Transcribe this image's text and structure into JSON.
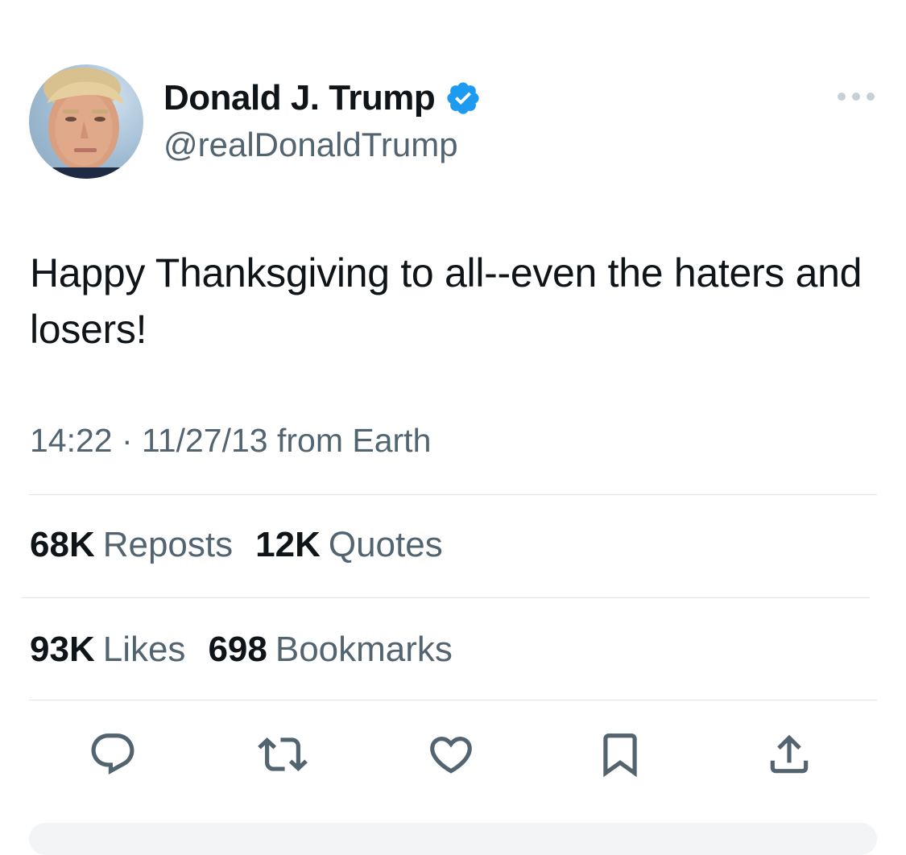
{
  "author": {
    "display_name": "Donald J. Trump",
    "handle": "@realDonaldTrump",
    "verified_icon": "verified-badge-icon",
    "avatar": "profile-photo"
  },
  "tweet": {
    "text": "Happy Thanksgiving to all--even the haters and losers!",
    "meta": "14:22 · 11/27/13 from Earth"
  },
  "stats": {
    "reposts_count": "68K",
    "reposts_label": "Reposts",
    "quotes_count": "12K",
    "quotes_label": "Quotes",
    "likes_count": "93K",
    "likes_label": "Likes",
    "bookmarks_count": "698",
    "bookmarks_label": "Bookmarks"
  },
  "actions": [
    "reply-icon",
    "repost-icon",
    "like-icon",
    "bookmark-icon",
    "share-icon"
  ],
  "colors": {
    "text_primary": "#0f1419",
    "text_secondary": "#536471",
    "verified_blue": "#1d9bf0",
    "divider": "#e1e6ea"
  }
}
